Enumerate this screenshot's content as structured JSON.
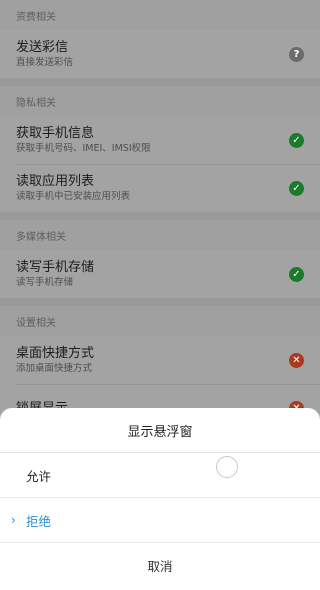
{
  "sections": [
    {
      "header": "资费相关",
      "items": [
        {
          "title": "发送彩信",
          "desc": "直接发送彩信",
          "status": "question",
          "status_glyph": "?"
        }
      ]
    },
    {
      "header": "隐私相关",
      "items": [
        {
          "title": "获取手机信息",
          "desc": "获取手机号码、IMEI、IMSI权限",
          "status": "check",
          "status_glyph": "✓"
        },
        {
          "title": "读取应用列表",
          "desc": "读取手机中已安装应用列表",
          "status": "check",
          "status_glyph": "✓"
        }
      ]
    },
    {
      "header": "多媒体相关",
      "items": [
        {
          "title": "读写手机存储",
          "desc": "读写手机存储",
          "status": "check",
          "status_glyph": "✓"
        }
      ]
    },
    {
      "header": "设置相关",
      "items": [
        {
          "title": "桌面快捷方式",
          "desc": "添加桌面快捷方式",
          "status": "cross",
          "status_glyph": "✕"
        },
        {
          "title": "锁屏显示",
          "desc": "",
          "status": "cross",
          "status_glyph": "✕"
        }
      ]
    }
  ],
  "dialog": {
    "title": "显示悬浮窗",
    "options": [
      {
        "label": "允许",
        "selected": false
      },
      {
        "label": "拒绝",
        "selected": true
      }
    ],
    "cancel_label": "取消"
  },
  "icons": {
    "question": "question-icon",
    "check": "check-icon",
    "cross": "cross-icon",
    "selected": "chevron-right-icon"
  },
  "colors": {
    "check": "#1d7a2c",
    "cross": "#a83a23",
    "question": "#6a6b6a",
    "selected_option": "#2e8fd3"
  }
}
